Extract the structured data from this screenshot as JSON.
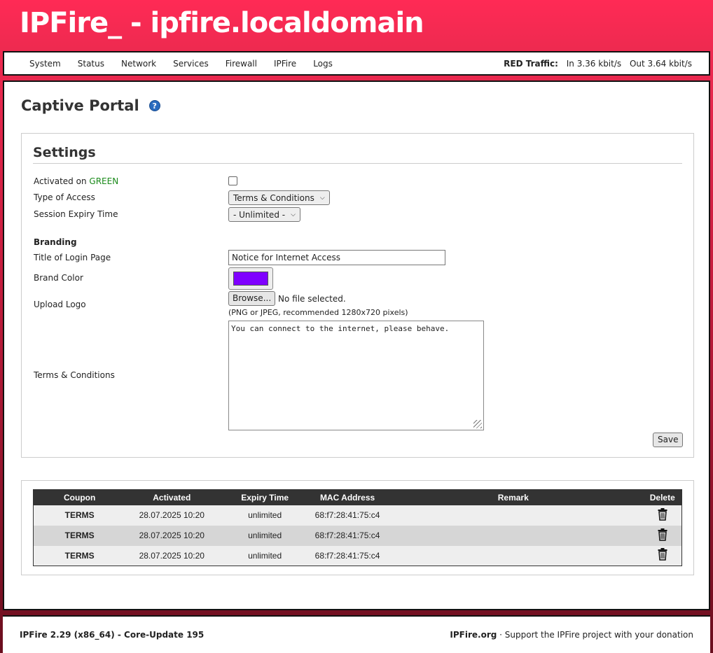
{
  "header": {
    "title": "IPFire_ - ipfire.localdomain"
  },
  "nav": {
    "items": [
      "System",
      "Status",
      "Network",
      "Services",
      "Firewall",
      "IPFire",
      "Logs"
    ],
    "traffic_label": "RED Traffic:",
    "traffic_in": "In 3.36 kbit/s",
    "traffic_out": "Out 3.64 kbit/s"
  },
  "page": {
    "title": "Captive Portal"
  },
  "settings": {
    "heading": "Settings",
    "activated_label": "Activated on",
    "activated_zone": "GREEN",
    "activated_checked": false,
    "access_label": "Type of Access",
    "access_value": "Terms & Conditions",
    "expiry_label": "Session Expiry Time",
    "expiry_value": "- Unlimited -",
    "branding_heading": "Branding",
    "login_title_label": "Title of Login Page",
    "login_title_value": "Notice for Internet Access",
    "brand_color_label": "Brand Color",
    "brand_color": "#7f00ff",
    "logo_label": "Upload Logo",
    "browse_label": "Browse...",
    "file_status": "No file selected.",
    "logo_hint": "(PNG or JPEG, recommended 1280x720 pixels)",
    "terms_label": "Terms & Conditions",
    "terms_value": "You can connect to the internet, please behave.",
    "save_label": "Save"
  },
  "coupons": {
    "headers": [
      "Coupon",
      "Activated",
      "Expiry Time",
      "MAC Address",
      "Remark",
      "Delete"
    ],
    "rows": [
      {
        "coupon": "TERMS",
        "activated": "28.07.2025 10:20",
        "expiry": "unlimited",
        "mac": "68:f7:28:41:75:c4",
        "remark": ""
      },
      {
        "coupon": "TERMS",
        "activated": "28.07.2025 10:20",
        "expiry": "unlimited",
        "mac": "68:f7:28:41:75:c4",
        "remark": ""
      },
      {
        "coupon": "TERMS",
        "activated": "28.07.2025 10:20",
        "expiry": "unlimited",
        "mac": "68:f7:28:41:75:c4",
        "remark": ""
      }
    ]
  },
  "footer": {
    "version": "IPFire 2.29 (x86_64) - Core-Update 195",
    "site": "IPFire.org",
    "support": " · Support the IPFire project with your donation"
  },
  "icons": {
    "help": "help-icon",
    "delete": "trash-icon"
  }
}
